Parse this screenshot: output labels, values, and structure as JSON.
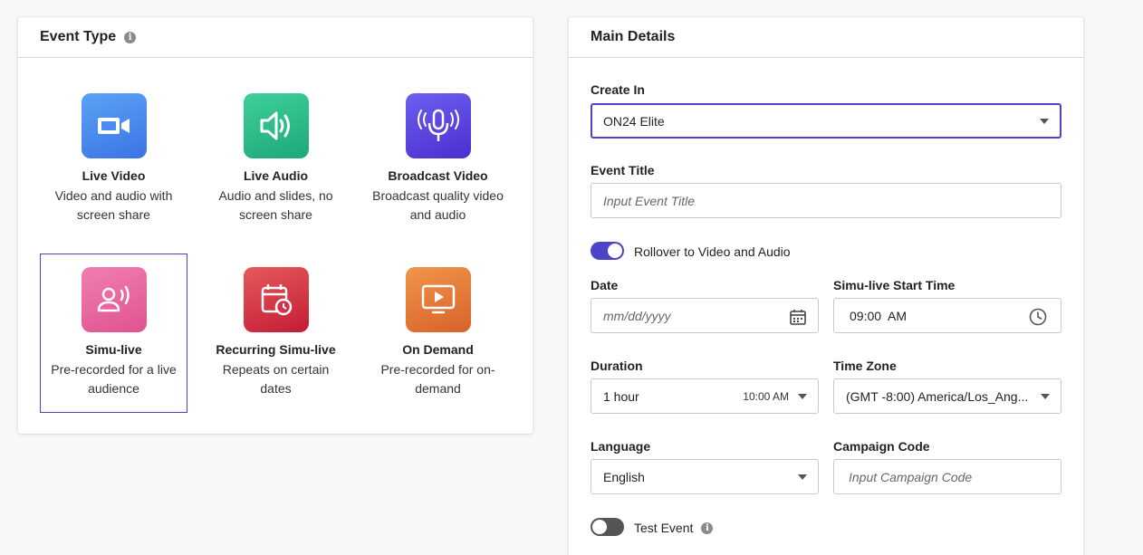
{
  "event_type": {
    "header": "Event Type",
    "types": [
      {
        "title": "Live Video",
        "desc": "Video and audio with screen share",
        "icon": "video-camera-icon",
        "color_from": "#5aa3f5",
        "color_to": "#3b74e6"
      },
      {
        "title": "Live Audio",
        "desc": "Audio and slides, no screen share",
        "icon": "speaker-icon",
        "color_from": "#3ed09a",
        "color_to": "#1ea877"
      },
      {
        "title": "Broadcast Video",
        "desc": "Broadcast quality video and audio",
        "icon": "broadcast-microphone-icon",
        "color_from": "#6d5ff0",
        "color_to": "#4a2fcf"
      },
      {
        "title": "Simu-live",
        "desc": "Pre-recorded for a live audience",
        "icon": "person-broadcast-icon",
        "color_from": "#f07eb0",
        "color_to": "#e05390",
        "selected": true
      },
      {
        "title": "Recurring Simu-live",
        "desc": "Repeats on certain dates",
        "icon": "calendar-repeat-icon",
        "color_from": "#e45a5a",
        "color_to": "#c41c36"
      },
      {
        "title": "On Demand",
        "desc": "Pre-recorded for on-demand",
        "icon": "play-screen-icon",
        "color_from": "#f0954a",
        "color_to": "#d8622a"
      }
    ]
  },
  "main_details": {
    "header": "Main Details",
    "create_in": {
      "label": "Create In",
      "value": "ON24 Elite"
    },
    "event_title": {
      "label": "Event Title",
      "placeholder": "Input Event Title"
    },
    "rollover": {
      "label": "Rollover to Video and Audio",
      "on": true
    },
    "date": {
      "label": "Date",
      "placeholder": "mm/dd/yyyy"
    },
    "start_time": {
      "label": "Simu-live Start Time",
      "value": "09:00  AM"
    },
    "duration": {
      "label": "Duration",
      "value": "1 hour",
      "end_time": "10:00 AM"
    },
    "time_zone": {
      "label": "Time Zone",
      "value": "(GMT -8:00) America/Los_Ang..."
    },
    "language": {
      "label": "Language",
      "value": "English"
    },
    "campaign_code": {
      "label": "Campaign Code",
      "placeholder": "Input Campaign Code"
    },
    "test_event": {
      "label": "Test Event",
      "on": false
    }
  },
  "colors": {
    "accent": "#4b44c9",
    "toggle_off": "#555555"
  }
}
